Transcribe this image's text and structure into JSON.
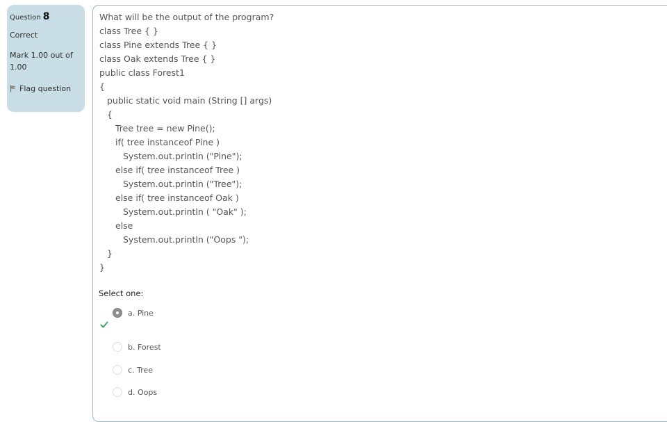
{
  "info": {
    "question_label": "Question",
    "question_number": "8",
    "state": "Correct",
    "grade": "Mark 1.00 out of 1.00",
    "flag_label": "Flag question"
  },
  "question": {
    "lines": [
      "What will be the output of the program?",
      "class Tree { }",
      "class Pine extends Tree { }",
      "class Oak extends Tree { }",
      "public class Forest1",
      "{",
      "public static void main (String [] args)",
      "{",
      "Tree tree = new Pine();",
      "if( tree instanceof Pine )",
      "System.out.println (\"Pine\");",
      "else if( tree instanceof Tree )",
      "System.out.println (\"Tree\");",
      "else if( tree instanceof Oak )",
      "System.out.println ( \"Oak\" );",
      "else",
      "System.out.println (\"Oops \");",
      "}",
      "}"
    ],
    "prompt": "Select one:",
    "options": [
      {
        "label": "a. Pine",
        "selected": true
      },
      {
        "label": "b. Forest",
        "selected": false
      },
      {
        "label": "c. Tree",
        "selected": false
      },
      {
        "label": "d. Oops",
        "selected": false
      }
    ]
  },
  "colors": {
    "info_bg": "#c8dde6",
    "border": "#9fb6c2",
    "correct": "#3fa66b"
  }
}
